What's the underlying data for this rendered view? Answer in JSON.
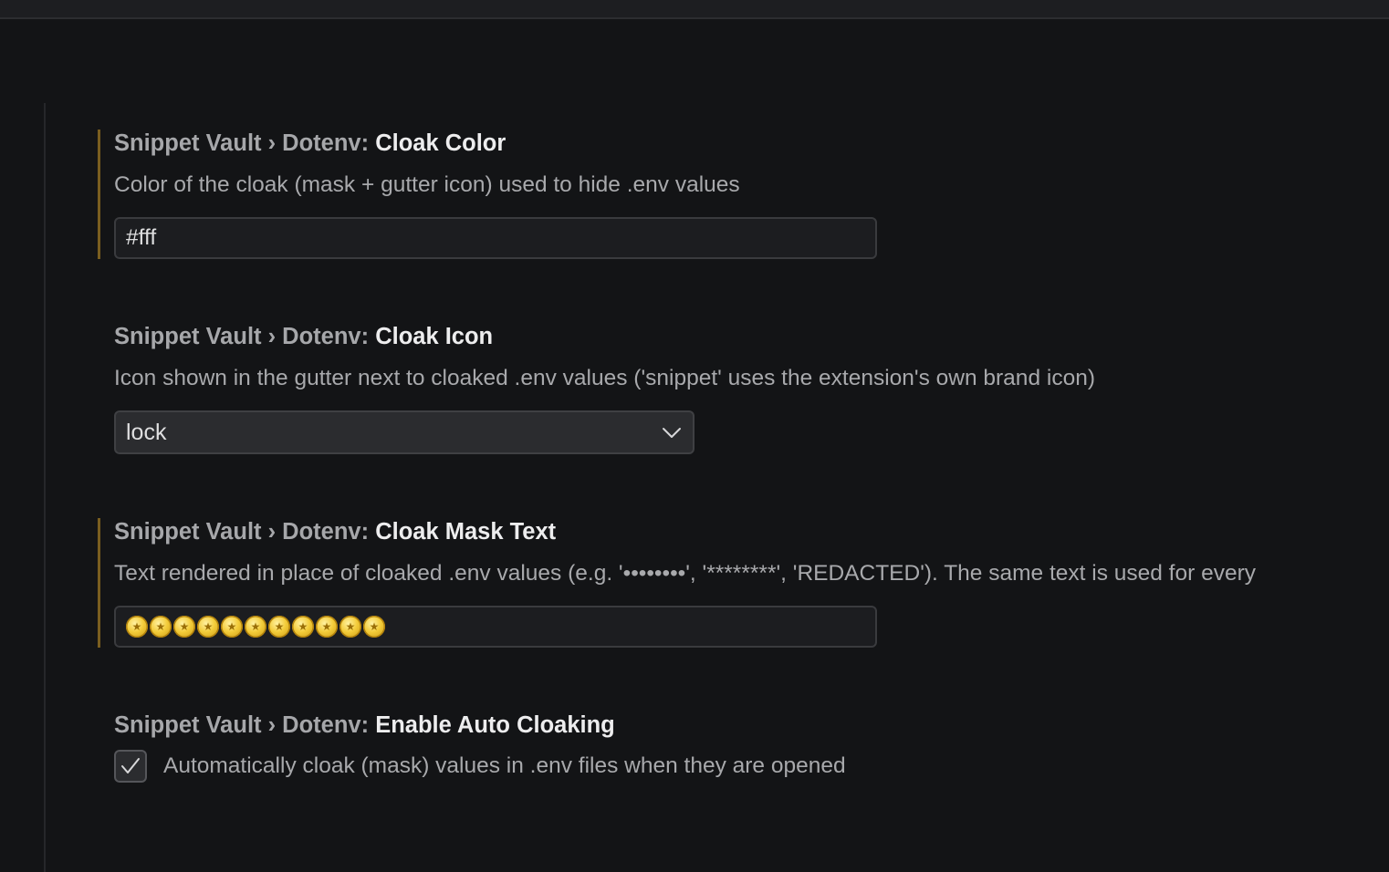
{
  "settings": [
    {
      "category": "Snippet Vault › Dotenv: ",
      "name": "Cloak Color",
      "description": "Color of the cloak (mask + gutter icon) used to hide .env values",
      "control": "text",
      "value": "#fff",
      "modified": true
    },
    {
      "category": "Snippet Vault › Dotenv: ",
      "name": "Cloak Icon",
      "description": "Icon shown in the gutter next to cloaked .env values ('snippet' uses the extension's own brand icon)",
      "control": "select",
      "value": "lock",
      "modified": false
    },
    {
      "category": "Snippet Vault › Dotenv: ",
      "name": "Cloak Mask Text",
      "description": "Text rendered in place of cloaked .env values (e.g. '••••••••', '********', 'REDACTED'). The same text is used for every",
      "control": "text",
      "value": "🌕🌕🌕🌕🌕🌕🌕🌕🌕🌕🌕",
      "value_icon": "gold-coin-emoji",
      "value_icon_count": 11,
      "modified": true
    },
    {
      "category": "Snippet Vault › Dotenv: ",
      "name": "Enable Auto Cloaking",
      "control": "checkbox",
      "checkbox_label": "Automatically cloak (mask) values in .env files when they are opened",
      "checked": true,
      "modified": false
    }
  ],
  "icons": {
    "dropdown": "chevron-down-icon",
    "check": "checkmark-icon"
  },
  "colors": {
    "background": "#131416",
    "modified_indicator": "#7a5e1f",
    "title_category": "#a6a7aa",
    "title_name": "#ededee",
    "description": "#a8a9ac"
  }
}
